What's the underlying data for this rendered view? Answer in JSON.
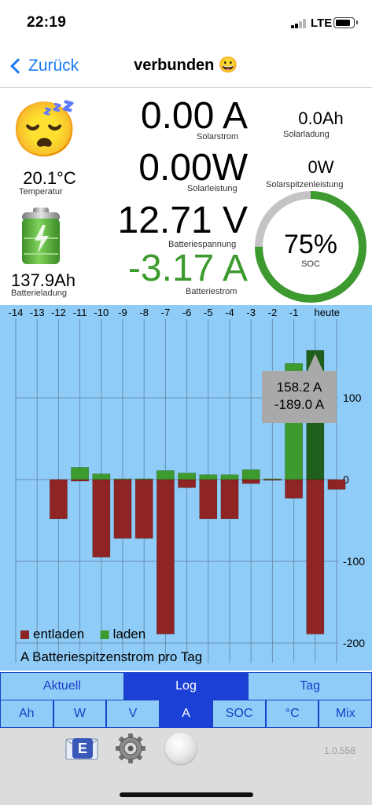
{
  "status_bar": {
    "time": "22:19",
    "network": "LTE"
  },
  "nav": {
    "back_label": "Zurück",
    "title": "verbunden 😀"
  },
  "metrics": {
    "status_emoji": "😴",
    "temperature": {
      "value": "20.1°C",
      "label": "Temperatur"
    },
    "battery_charge": {
      "value": "137.9Ah",
      "label": "Batterieladung"
    },
    "solar_current": {
      "value": "0.00 A",
      "label": "Solarstrom"
    },
    "solar_charge": {
      "value": "0.0Ah",
      "label": "Solarladung"
    },
    "solar_power": {
      "value": "0.00W",
      "label": "Solarleistung"
    },
    "solar_peak_power": {
      "value": "0W",
      "label": "Solarspitzenleistung"
    },
    "battery_voltage": {
      "value": "12.71 V",
      "label": "Batteriespannung"
    },
    "battery_current": {
      "value": "-3.17 A",
      "label": "Batteriestrom"
    },
    "soc": {
      "value": "75%",
      "label": "SOC",
      "percent": 75
    }
  },
  "colors": {
    "accent": "#1a7cf5",
    "charge_green": "#3d9a2e",
    "discharge_red": "#8e2424",
    "soc_green": "#3d9a2e",
    "soc_gray": "#c4c4c4",
    "chart_bg": "#8fcdf8",
    "segment_blue": "#1b40d6"
  },
  "chart_data": {
    "type": "bar",
    "title": "A Batteriespitzenstrom pro Tag",
    "categories": [
      "-14",
      "-13",
      "-12",
      "-11",
      "-10",
      "-9",
      "-8",
      "-7",
      "-6",
      "-5",
      "-4",
      "-3",
      "-2",
      "-1",
      "heute"
    ],
    "series": [
      {
        "name": "entladen",
        "color": "#8e2424",
        "values": [
          0,
          -48,
          -2,
          -95,
          -72,
          -72,
          -189,
          -10,
          -48,
          -48,
          -5,
          -1,
          -23,
          -189,
          -12
        ]
      },
      {
        "name": "laden",
        "color": "#3d9a2e",
        "values": [
          0,
          0,
          15,
          7,
          1,
          1,
          11,
          8,
          6,
          6,
          12,
          1,
          142,
          158.2,
          0
        ]
      }
    ],
    "ylim": [
      -210,
      170
    ],
    "yticks": [
      100,
      0,
      -100,
      -200
    ],
    "grid": true,
    "legend_position": "bottom-left",
    "selected_category": "-1",
    "tooltip_lines": [
      "158.2 A",
      "-189.0 A"
    ]
  },
  "segments": {
    "period": [
      {
        "label": "Aktuell",
        "active": false
      },
      {
        "label": "Log",
        "active": true
      },
      {
        "label": "Tag",
        "active": false
      }
    ],
    "unit": [
      {
        "label": "Ah",
        "active": false
      },
      {
        "label": "W",
        "active": false
      },
      {
        "label": "V",
        "active": false
      },
      {
        "label": "A",
        "active": true
      },
      {
        "label": "SOC",
        "active": false
      },
      {
        "label": "°C",
        "active": false
      },
      {
        "label": "Mix",
        "active": false
      }
    ]
  },
  "toolbar": {
    "mail_icon_letter": "E",
    "version": "1.0.558"
  }
}
